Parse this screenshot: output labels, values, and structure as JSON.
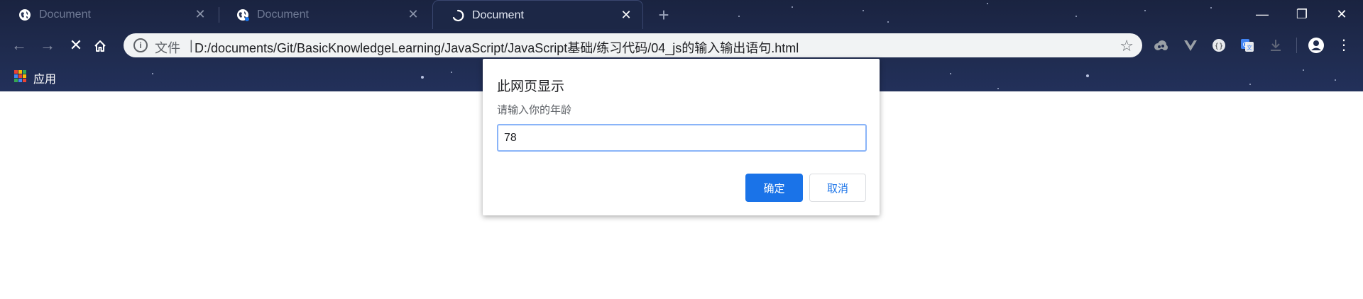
{
  "tabs": [
    {
      "title": "Document",
      "state": "inactive",
      "favicon": "globe-icon"
    },
    {
      "title": "Document",
      "state": "inactive",
      "favicon": "globe-icon"
    },
    {
      "title": "Document",
      "state": "active-loading",
      "favicon": "loading-spinner-icon"
    }
  ],
  "window_controls": {
    "minimize": "—",
    "restore": "❐",
    "close": "✕"
  },
  "omnibox": {
    "security_label": "文件",
    "separator": "|",
    "url": "D:/documents/Git/BasicKnowledgeLearning/JavaScript/JavaScript基础/练习代码/04_js的输入输出语句.html"
  },
  "bookmarks": {
    "apps_label": "应用"
  },
  "dialog": {
    "title": "此网页显示",
    "message": "请输入你的年龄",
    "input_value": "78",
    "ok_label": "确定",
    "cancel_label": "取消"
  },
  "colors": {
    "accent": "#1a73e8",
    "focus_ring": "#8ab4f8",
    "chrome_bg": "#1f2b4e"
  }
}
